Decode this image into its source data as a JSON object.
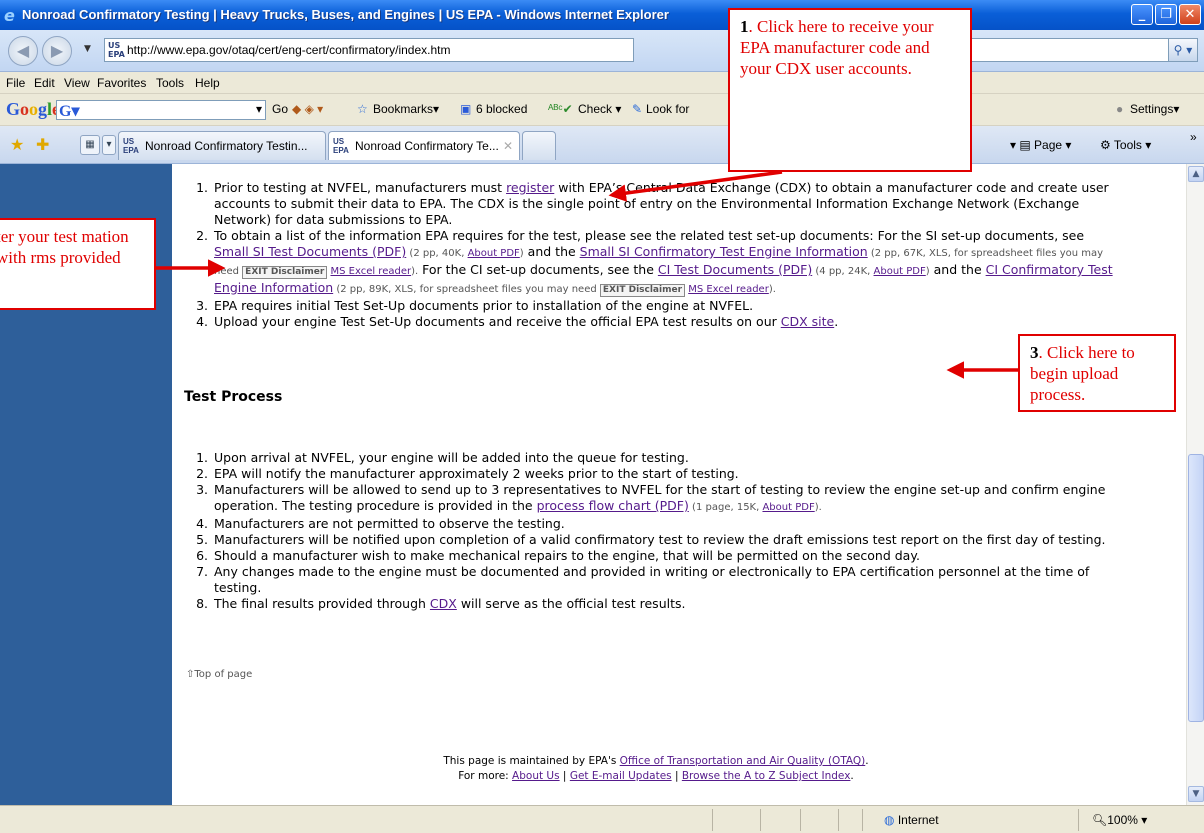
{
  "window": {
    "title": "Nonroad Confirmatory Testing | Heavy Trucks, Buses, and Engines | US EPA - Windows Internet Explorer",
    "minimize": "_",
    "maximize": "❐",
    "close": "✕"
  },
  "address": {
    "favicon": "US EPA",
    "url": "http://www.epa.gov/otaq/cert/eng-cert/confirmatory/index.htm"
  },
  "menu": [
    "File",
    "Edit",
    "View",
    "Favorites",
    "Tools",
    "Help"
  ],
  "google_toolbar": {
    "logo": "Google",
    "go": "Go",
    "bookmarks": "Bookmarks",
    "blocked": "6 blocked",
    "check": "Check",
    "look_for": "Look for",
    "settings": "Settings"
  },
  "tabs": [
    {
      "label": "Nonroad Confirmatory Testin...",
      "icon": "US EPA"
    },
    {
      "label": "Nonroad Confirmatory Te...",
      "icon": "US EPA",
      "close": "✕"
    }
  ],
  "commands": {
    "page": "Page",
    "tools": "Tools"
  },
  "content": {
    "steps": {
      "s1_pre": "Prior to testing at NVFEL, manufacturers must ",
      "s1_link": "register",
      "s1_post": " with EPA’s Central Data Exchange (CDX) to obtain a manufacturer code and create user accounts to submit their data to EPA. The CDX is the single point of entry on the Environmental Information Exchange Network (Exchange Network) for data submissions to EPA.",
      "s2_a": "To obtain a list of the information EPA requires for the test, please see the related test set-up documents: For the SI set-up documents, see ",
      "s2_link1": "Small SI Test Documents (PDF)",
      "s2_small1": " (2 pp, 40K, ",
      "s2_about1": "About PDF",
      "s2_small1_end": ")",
      "s2_and1": " and the ",
      "s2_link2": "Small SI Confirmatory Test Engine Information",
      "s2_small2": " (2 pp, 67K, XLS, for spreadsheet files you may need ",
      "s2_exit": "EXIT Disclaimer",
      "s2_excel1": "MS Excel reader",
      "s2_small2_end": ").",
      "s2_b": "  For the CI set-up documents, see the ",
      "s2_link3": "CI Test Documents (PDF)",
      "s2_small3": " (4 pp, 24K, ",
      "s2_about2": "About PDF",
      "s2_small3_end": ")",
      "s2_and2": " and the ",
      "s2_link4": "CI Confirmatory Test Engine Information",
      "s2_small4": " (2 pp, 89K, XLS, for spreadsheet files you may need ",
      "s2_exit2": "EXIT Disclaimer",
      "s2_excel2": "MS Excel reader",
      "s2_small4_end": ").",
      "s3": "EPA requires initial Test Set-Up documents prior to installation of the engine at NVFEL.",
      "s4_pre": "Upload your engine Test Set-Up documents and receive the official EPA test results on our ",
      "s4_link": "CDX site",
      "s4_post": "."
    },
    "process_heading": "Test Process",
    "process": {
      "p1": "Upon arrival at NVFEL, your engine will be added into the queue for testing.",
      "p2": "EPA will notify the manufacturer approximately 2 weeks prior to the start of testing.",
      "p3_pre": "Manufacturers will be allowed to send up to 3 representatives to NVFEL for the start of testing to review the engine set-up and confirm engine operation.  The testing procedure is provided in the ",
      "p3_link": "process flow chart (PDF)",
      "p3_small": " (1 page, 15K, ",
      "p3_about": "About PDF",
      "p3_small_end": ").",
      "p4": "Manufacturers are not permitted to observe the testing.",
      "p5": "Manufacturers will be notified upon completion of a valid confirmatory test to review the draft emissions test report on the first day of testing.",
      "p6": "Should a manufacturer wish to make mechanical repairs to the engine, that will be permitted on the second day.",
      "p7": "Any changes made to the engine must be documented and provided in writing or electronically to EPA certification personnel at the time of testing.",
      "p8_pre": "The final results provided through ",
      "p8_link": "CDX",
      "p8_post": " will serve as the official test results."
    },
    "top_of_page": "Top of page",
    "footer": {
      "l1_pre": "This page is maintained by EPA's ",
      "l1_link": "Office of Transportation and Air Quality (OTAQ)",
      "l1_post": ".",
      "l2_pre": "For more: ",
      "about": "About Us",
      "updates": "Get E-mail Updates",
      "index": "Browse the A to Z Subject Index",
      "sep": " | ",
      "end": "."
    }
  },
  "status": {
    "zone": "Internet",
    "zoom": "100%"
  },
  "callouts": {
    "c1_num": "1",
    "c1_text": ". Click here to receive your  EPA manufacturer code  and your CDX user accounts.",
    "c2_text": "ter your test mation with rms provided",
    "c3_num": "3",
    "c3_text": ". Click here to begin upload process."
  },
  "colors": {
    "accent_red": "#e00000",
    "sidebar": "#2e5f9a",
    "link": "#551a8b"
  }
}
